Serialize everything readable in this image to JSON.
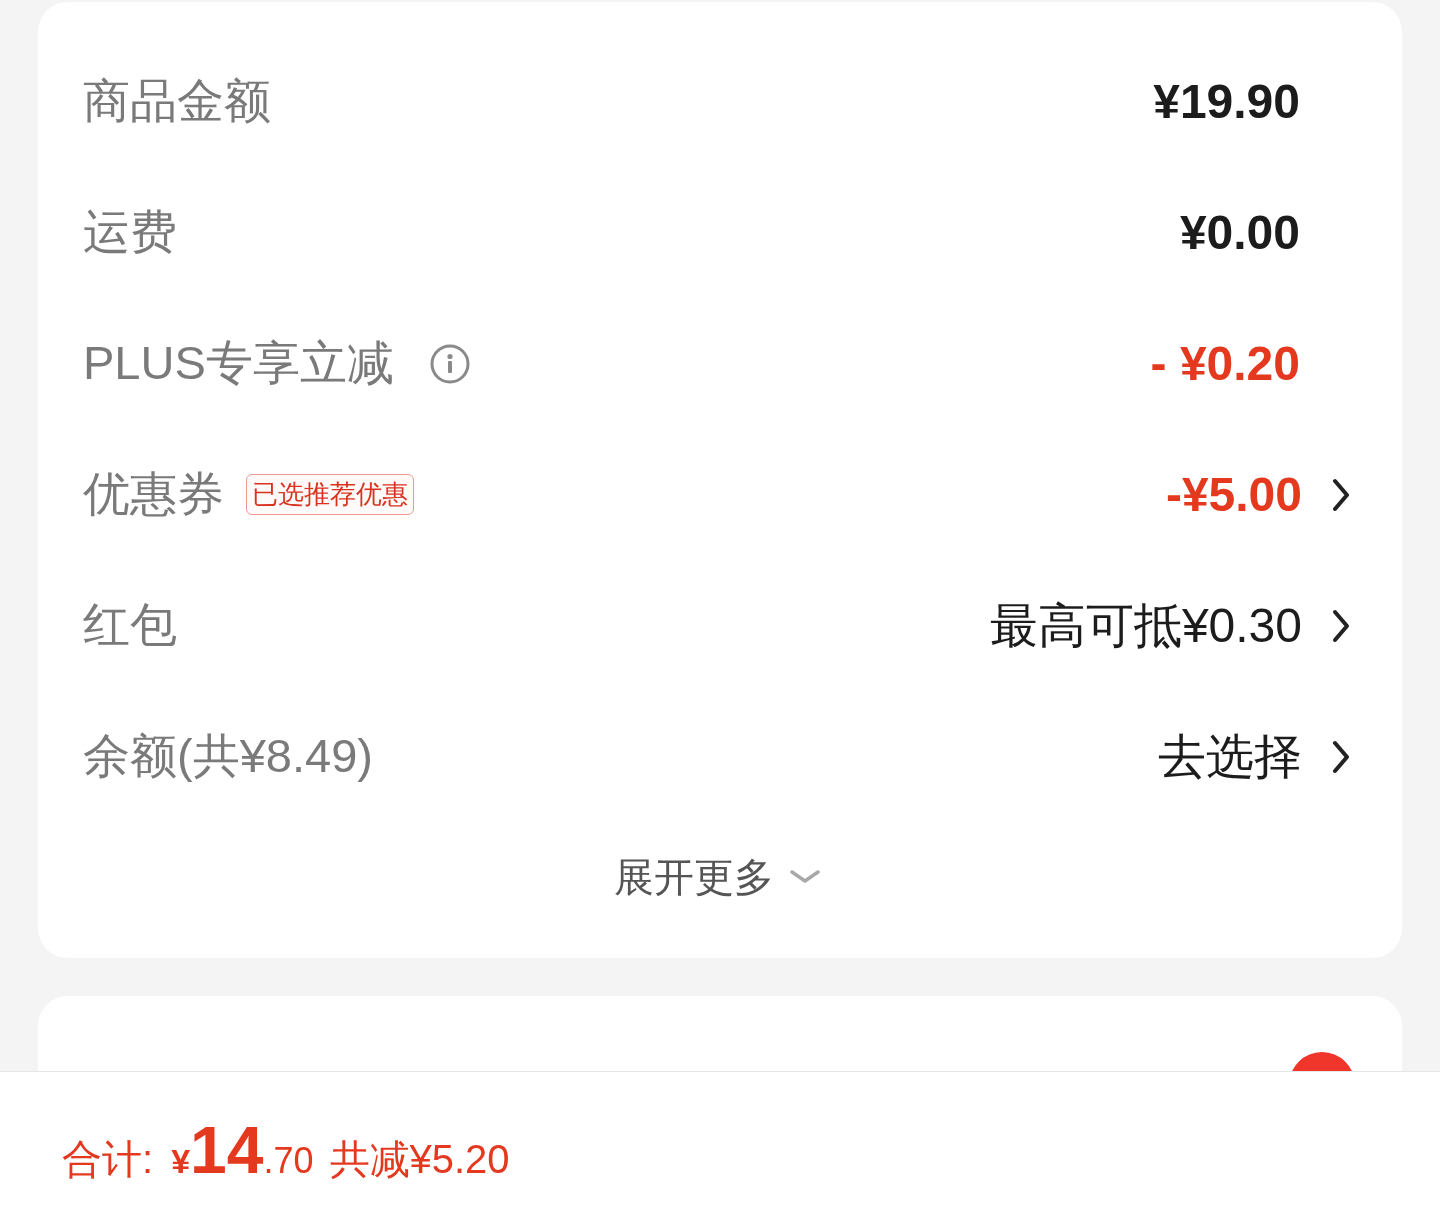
{
  "summary_rows": [
    {
      "label": "商品金额",
      "value": "¥19.90",
      "kind": "amount",
      "info": false,
      "chevron": false
    },
    {
      "label": "运费",
      "value": "¥0.00",
      "kind": "amount",
      "info": false,
      "chevron": false
    },
    {
      "label": "PLUS专享立减",
      "value": "- ¥0.20",
      "kind": "discount",
      "info": true,
      "chevron": false
    },
    {
      "label": "优惠券",
      "badge": "已选推荐优惠",
      "value": "-¥5.00",
      "kind": "discount",
      "info": false,
      "chevron": true
    },
    {
      "label": "红包",
      "value": "最高可抵¥0.30",
      "kind": "action",
      "info": false,
      "chevron": true
    },
    {
      "label": "余额(共¥8.49)",
      "value": "去选择",
      "kind": "action",
      "info": false,
      "chevron": true
    }
  ],
  "expand_more": {
    "label": "展开更多"
  },
  "total": {
    "label": "合计:",
    "currency": "¥",
    "integer": "14",
    "decimal": ".70",
    "savings": "共减¥5.20"
  }
}
